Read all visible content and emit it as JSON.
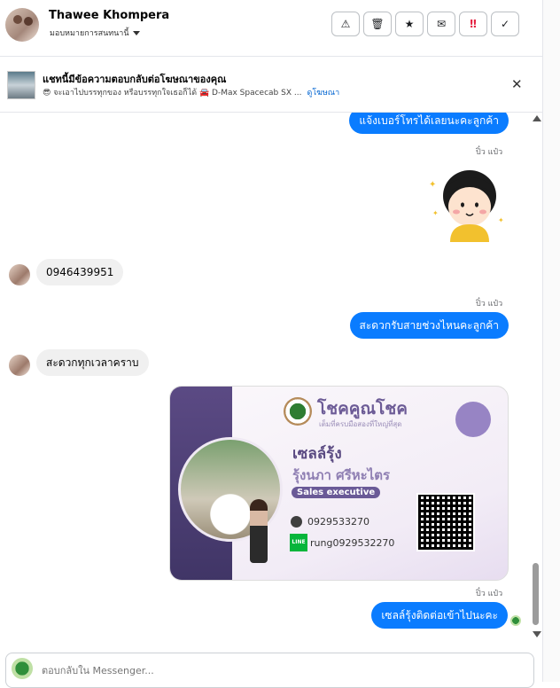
{
  "header": {
    "contact_name": "Thawee Khompera",
    "assign_label": "มอบหมายการสนทนานี้",
    "tools": [
      {
        "name": "warning-icon",
        "glyph": "⚠"
      },
      {
        "name": "trash-icon",
        "glyph": "🗑"
      },
      {
        "name": "star-icon",
        "glyph": "★"
      },
      {
        "name": "mail-icon",
        "glyph": "✉"
      },
      {
        "name": "important-icon",
        "glyph": "‼"
      },
      {
        "name": "check-icon",
        "glyph": "✓"
      }
    ]
  },
  "ad": {
    "title": "แชทนี้มีข้อความตอบกลับต่อโฆษณาของคุณ",
    "subtitle": "😎 จะเอาไปบรรทุกของ หรือบรรทุกใจเธอก็ได้ 🚘 D-Max Spacecab SX ...",
    "link": "ดูโฆษณา",
    "close_glyph": "✕"
  },
  "messages": {
    "m1": "แจ้งเบอร์โทรได้เลยนะคะลูกค้า",
    "m1_sender": "ปิ๋ว แป๋ว",
    "m2": "0946439951",
    "m3_sender": "ปิ๋ว แป๋ว",
    "m3": "สะดวกรับสายช่วงไหนคะลูกค้า",
    "m4": "สะดวกทุกเวลาคราบ",
    "m5_sender": "ปิ๋ว แป๋ว",
    "m5": "เซลล์รุ้งติดต่อเข้าไปนะคะ"
  },
  "card": {
    "brand": "โชคคูณโชค",
    "brand_sub": "เต็มที่ครบมือสองที่ใหญ่ที่สุด",
    "title": "เซลล์รุ้ง",
    "name": "รุ้งนภา ศรีหะไตร",
    "role": "Sales executive",
    "phone": "0929533270",
    "line": "rung0929532270",
    "line_badge": "LINE"
  },
  "composer": {
    "placeholder": "ตอบกลับใน Messenger..."
  }
}
